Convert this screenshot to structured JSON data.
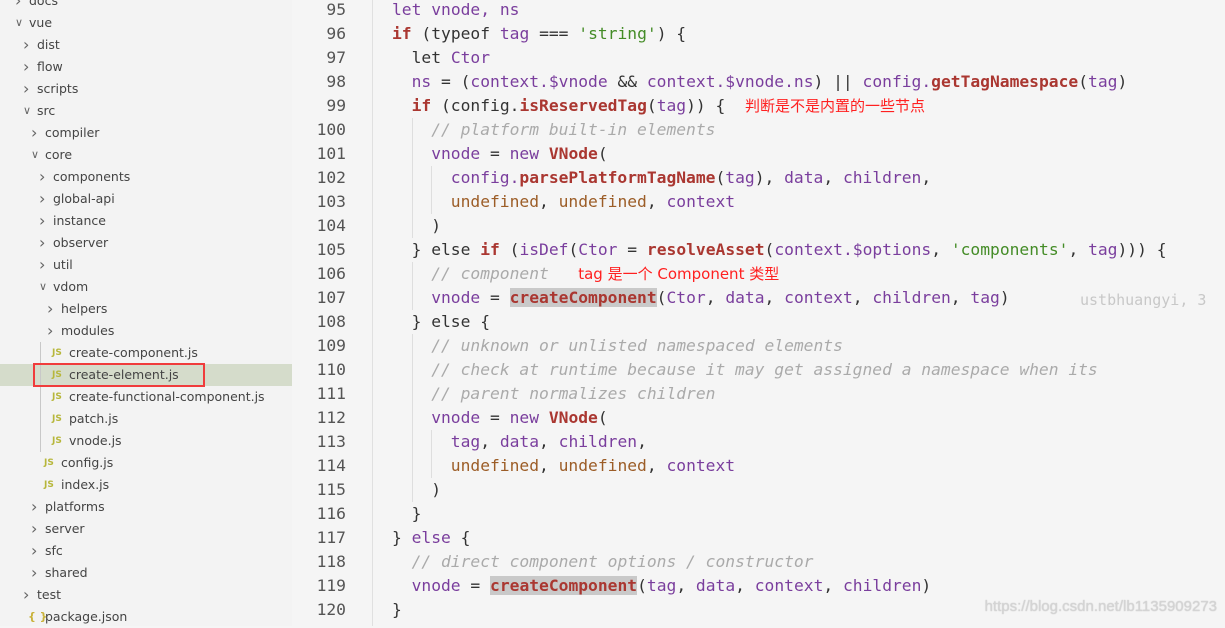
{
  "explorer": {
    "items": [
      {
        "label": "docs",
        "type": "folder",
        "open": false,
        "depth": 0
      },
      {
        "label": "vue",
        "type": "folder",
        "open": true,
        "depth": 0
      },
      {
        "label": "dist",
        "type": "folder",
        "open": false,
        "depth": 1
      },
      {
        "label": "flow",
        "type": "folder",
        "open": false,
        "depth": 1
      },
      {
        "label": "scripts",
        "type": "folder",
        "open": false,
        "depth": 1
      },
      {
        "label": "src",
        "type": "folder",
        "open": true,
        "depth": 1
      },
      {
        "label": "compiler",
        "type": "folder",
        "open": false,
        "depth": 2
      },
      {
        "label": "core",
        "type": "folder",
        "open": true,
        "depth": 2
      },
      {
        "label": "components",
        "type": "folder",
        "open": false,
        "depth": 3
      },
      {
        "label": "global-api",
        "type": "folder",
        "open": false,
        "depth": 3
      },
      {
        "label": "instance",
        "type": "folder",
        "open": false,
        "depth": 3
      },
      {
        "label": "observer",
        "type": "folder",
        "open": false,
        "depth": 3
      },
      {
        "label": "util",
        "type": "folder",
        "open": false,
        "depth": 3
      },
      {
        "label": "vdom",
        "type": "folder",
        "open": true,
        "depth": 3
      },
      {
        "label": "helpers",
        "type": "folder",
        "open": false,
        "depth": 4
      },
      {
        "label": "modules",
        "type": "folder",
        "open": false,
        "depth": 4
      },
      {
        "label": "create-component.js",
        "type": "js",
        "depth": 4
      },
      {
        "label": "create-element.js",
        "type": "js",
        "depth": 4,
        "selected": true
      },
      {
        "label": "create-functional-component.js",
        "type": "js",
        "depth": 4
      },
      {
        "label": "patch.js",
        "type": "js",
        "depth": 4
      },
      {
        "label": "vnode.js",
        "type": "js",
        "depth": 4
      },
      {
        "label": "config.js",
        "type": "js",
        "depth": 3
      },
      {
        "label": "index.js",
        "type": "js",
        "depth": 3
      },
      {
        "label": "platforms",
        "type": "folder",
        "open": false,
        "depth": 2
      },
      {
        "label": "server",
        "type": "folder",
        "open": false,
        "depth": 2
      },
      {
        "label": "sfc",
        "type": "folder",
        "open": false,
        "depth": 2
      },
      {
        "label": "shared",
        "type": "folder",
        "open": false,
        "depth": 2
      },
      {
        "label": "test",
        "type": "folder",
        "open": false,
        "depth": 1
      },
      {
        "label": "package.json",
        "type": "json",
        "depth": 1
      }
    ],
    "js_icon": "JS",
    "json_icon": "{ }",
    "highlight_color": "#f03c3c"
  },
  "editor": {
    "lines": [
      {
        "n": "95",
        "indent": 0,
        "tokens": [
          [
            "v",
            "let vnode, ns"
          ]
        ]
      },
      {
        "n": "96",
        "indent": 0,
        "tokens": [
          [
            "k",
            "if"
          ],
          [
            "p",
            " (typeof "
          ],
          [
            "v",
            "tag"
          ],
          [
            "p",
            " === "
          ],
          [
            "s",
            "'string'"
          ],
          [
            "p",
            ") {"
          ]
        ]
      },
      {
        "n": "97",
        "indent": 1,
        "tokens": [
          [
            "p",
            "let "
          ],
          [
            "v",
            "Ctor"
          ]
        ]
      },
      {
        "n": "98",
        "indent": 1,
        "tokens": [
          [
            "v",
            "ns"
          ],
          [
            "p",
            " = ("
          ],
          [
            "v",
            "context.$vnode"
          ],
          [
            "p",
            " && "
          ],
          [
            "v",
            "context.$vnode.ns"
          ],
          [
            "p",
            ") || "
          ],
          [
            "v",
            "config."
          ],
          [
            "f",
            "getTagNamespace"
          ],
          [
            "p",
            "("
          ],
          [
            "v",
            "tag"
          ],
          [
            "p",
            ")"
          ]
        ]
      },
      {
        "n": "99",
        "indent": 1,
        "tokens": [
          [
            "k",
            "if"
          ],
          [
            "p",
            " (config."
          ],
          [
            "f",
            "isReservedTag"
          ],
          [
            "p",
            "("
          ],
          [
            "v",
            "tag"
          ],
          [
            "p",
            ")) {  "
          ],
          [
            "n",
            "判断是不是内置的一些节点"
          ]
        ]
      },
      {
        "n": "100",
        "indent": 2,
        "tokens": [
          [
            "c",
            "// platform built-in elements"
          ]
        ]
      },
      {
        "n": "101",
        "indent": 2,
        "tokens": [
          [
            "v",
            "vnode"
          ],
          [
            "p",
            " = "
          ],
          [
            "v",
            "new "
          ],
          [
            "f",
            "VNode"
          ],
          [
            "p",
            "("
          ]
        ]
      },
      {
        "n": "102",
        "indent": 3,
        "tokens": [
          [
            "v",
            "config."
          ],
          [
            "f",
            "parsePlatformTagName"
          ],
          [
            "p",
            "("
          ],
          [
            "v",
            "tag"
          ],
          [
            "p",
            "), "
          ],
          [
            "v",
            "data"
          ],
          [
            "p",
            ", "
          ],
          [
            "v",
            "children"
          ],
          [
            "p",
            ","
          ]
        ]
      },
      {
        "n": "103",
        "indent": 3,
        "tokens": [
          [
            "u",
            "undefined"
          ],
          [
            "p",
            ", "
          ],
          [
            "u",
            "undefined"
          ],
          [
            "p",
            ", "
          ],
          [
            "v",
            "context"
          ]
        ]
      },
      {
        "n": "104",
        "indent": 2,
        "tokens": [
          [
            "p",
            ")"
          ]
        ]
      },
      {
        "n": "105",
        "indent": 1,
        "tokens": [
          [
            "p",
            "} else "
          ],
          [
            "k",
            "if"
          ],
          [
            "p",
            " ("
          ],
          [
            "v",
            "isDef"
          ],
          [
            "p",
            "("
          ],
          [
            "v",
            "Ctor"
          ],
          [
            "p",
            " = "
          ],
          [
            "f",
            "resolveAsset"
          ],
          [
            "p",
            "("
          ],
          [
            "v",
            "context.$options"
          ],
          [
            "p",
            ", "
          ],
          [
            "s",
            "'components'"
          ],
          [
            "p",
            ", "
          ],
          [
            "v",
            "tag"
          ],
          [
            "p",
            "))) {"
          ]
        ]
      },
      {
        "n": "106",
        "indent": 2,
        "tokens": [
          [
            "c",
            "// component   "
          ],
          [
            "n",
            "tag 是一个 Component 类型"
          ]
        ]
      },
      {
        "n": "107",
        "indent": 2,
        "tokens": [
          [
            "v",
            "vnode"
          ],
          [
            "p",
            " = "
          ],
          [
            "h",
            "createComponent"
          ],
          [
            "p",
            "("
          ],
          [
            "v",
            "Ctor"
          ],
          [
            "p",
            ", "
          ],
          [
            "v",
            "data"
          ],
          [
            "p",
            ", "
          ],
          [
            "v",
            "context"
          ],
          [
            "p",
            ", "
          ],
          [
            "v",
            "children"
          ],
          [
            "p",
            ", "
          ],
          [
            "v",
            "tag"
          ],
          [
            "p",
            ")"
          ]
        ]
      },
      {
        "n": "108",
        "indent": 1,
        "tokens": [
          [
            "p",
            "} else {"
          ]
        ]
      },
      {
        "n": "109",
        "indent": 2,
        "tokens": [
          [
            "c",
            "// unknown or unlisted namespaced elements"
          ]
        ]
      },
      {
        "n": "110",
        "indent": 2,
        "tokens": [
          [
            "c",
            "// check at runtime because it may get assigned a namespace when its"
          ]
        ]
      },
      {
        "n": "111",
        "indent": 2,
        "tokens": [
          [
            "c",
            "// parent normalizes children"
          ]
        ]
      },
      {
        "n": "112",
        "indent": 2,
        "tokens": [
          [
            "v",
            "vnode"
          ],
          [
            "p",
            " = "
          ],
          [
            "v",
            "new "
          ],
          [
            "f",
            "VNode"
          ],
          [
            "p",
            "("
          ]
        ]
      },
      {
        "n": "113",
        "indent": 3,
        "tokens": [
          [
            "v",
            "tag"
          ],
          [
            "p",
            ", "
          ],
          [
            "v",
            "data"
          ],
          [
            "p",
            ", "
          ],
          [
            "v",
            "children"
          ],
          [
            "p",
            ","
          ]
        ]
      },
      {
        "n": "114",
        "indent": 3,
        "tokens": [
          [
            "u",
            "undefined"
          ],
          [
            "p",
            ", "
          ],
          [
            "u",
            "undefined"
          ],
          [
            "p",
            ", "
          ],
          [
            "v",
            "context"
          ]
        ]
      },
      {
        "n": "115",
        "indent": 2,
        "tokens": [
          [
            "p",
            ")"
          ]
        ]
      },
      {
        "n": "116",
        "indent": 1,
        "tokens": [
          [
            "p",
            "}"
          ]
        ]
      },
      {
        "n": "117",
        "indent": 0,
        "tokens": [
          [
            "p",
            "} "
          ],
          [
            "v",
            "else"
          ],
          [
            "p",
            " {"
          ]
        ]
      },
      {
        "n": "118",
        "indent": 1,
        "tokens": [
          [
            "c",
            "// direct component options / constructor"
          ]
        ]
      },
      {
        "n": "119",
        "indent": 1,
        "tokens": [
          [
            "v",
            "vnode"
          ],
          [
            "p",
            " = "
          ],
          [
            "h",
            "createComponent"
          ],
          [
            "p",
            "("
          ],
          [
            "v",
            "tag"
          ],
          [
            "p",
            ", "
          ],
          [
            "v",
            "data"
          ],
          [
            "p",
            ", "
          ],
          [
            "v",
            "context"
          ],
          [
            "p",
            ", "
          ],
          [
            "v",
            "children"
          ],
          [
            "p",
            ")"
          ]
        ]
      },
      {
        "n": "120",
        "indent": 0,
        "tokens": [
          [
            "p",
            "}"
          ]
        ]
      }
    ],
    "blame": "ustbhuangyi, 3",
    "watermark": "https://blog.csdn.net/lb1135909273"
  }
}
